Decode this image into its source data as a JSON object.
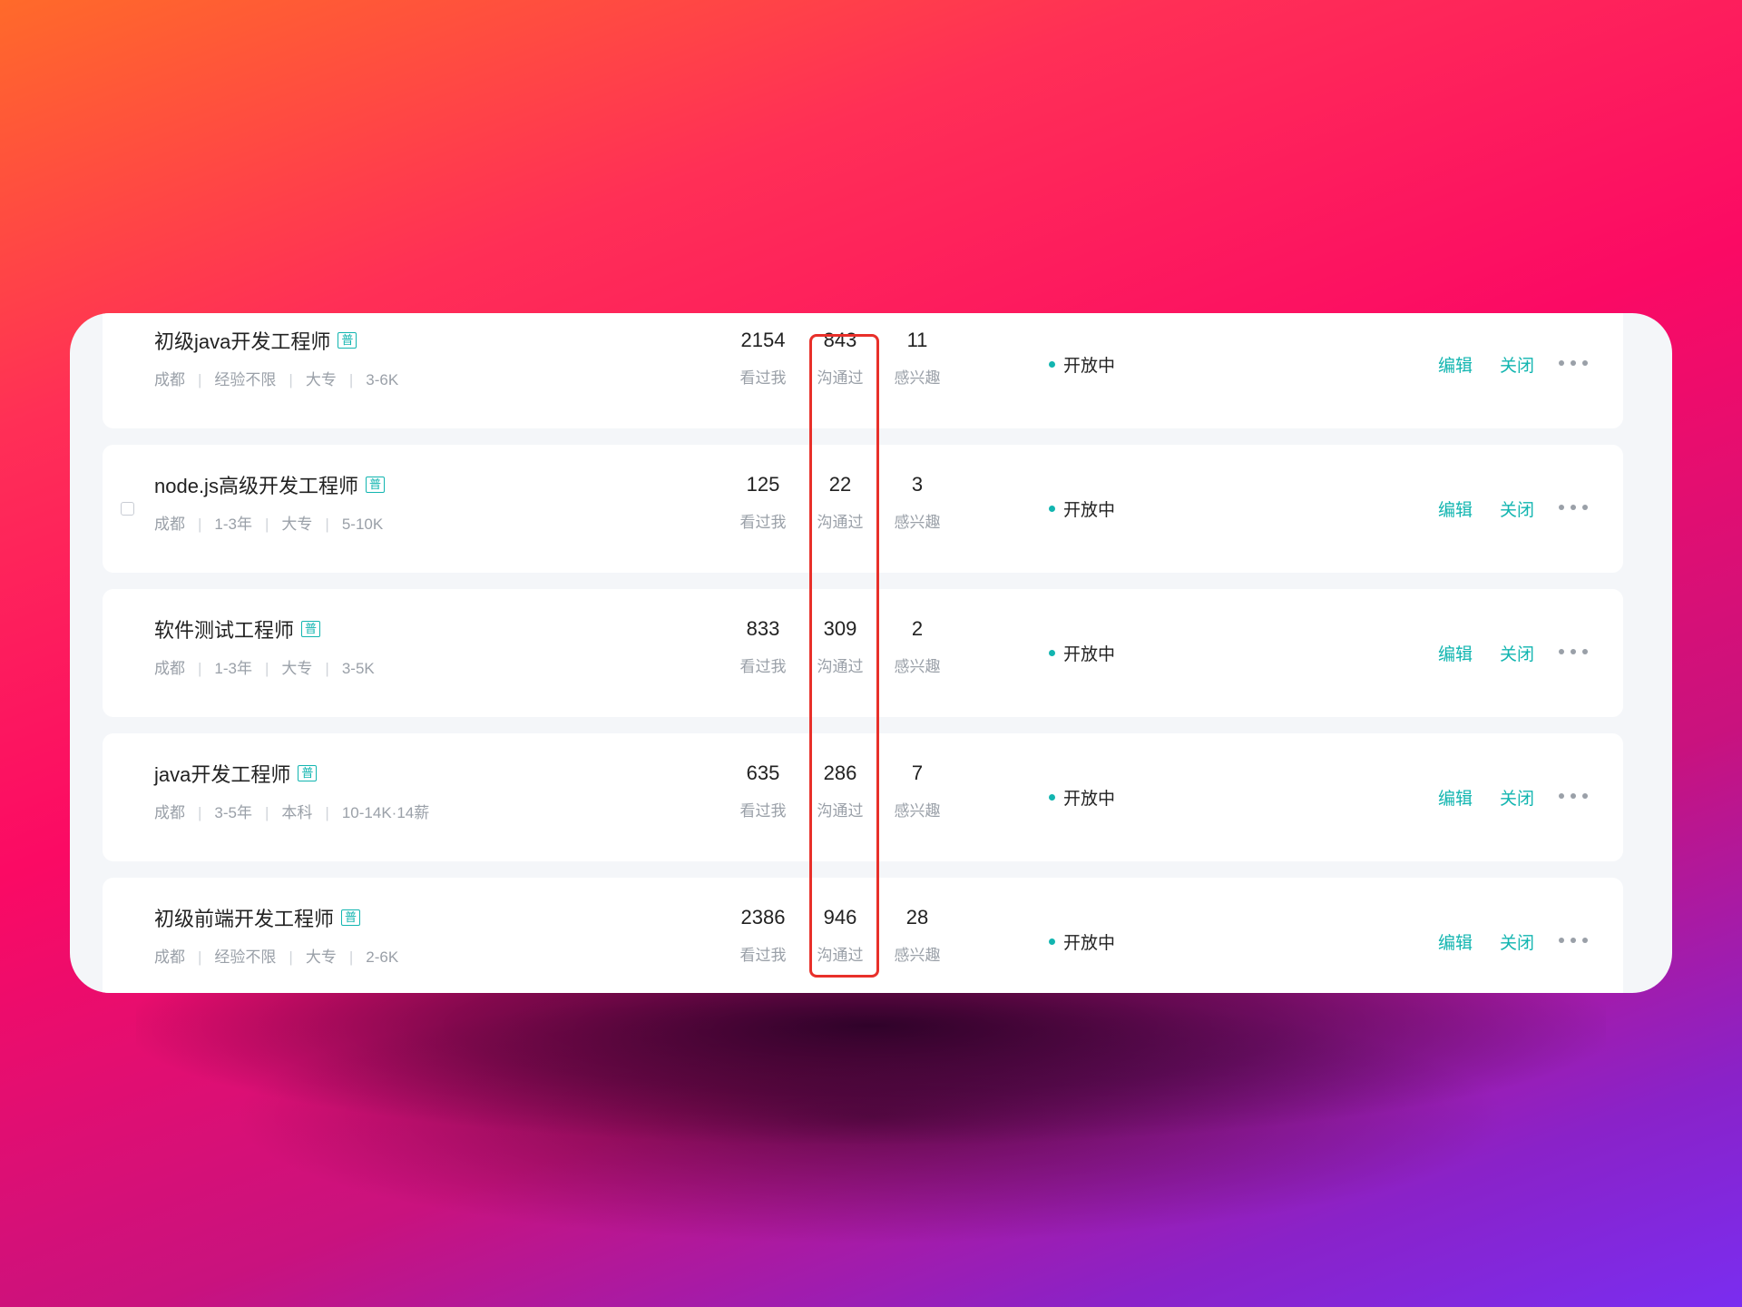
{
  "colors": {
    "accent": "#12b5b0",
    "highlight_border": "#e8302a",
    "status_dot": "#12b5b0"
  },
  "labels": {
    "viewed": "看过我",
    "contacted": "沟通过",
    "interested": "感兴趣",
    "edit": "编辑",
    "close": "关闭"
  },
  "jobs": [
    {
      "title": "初级java开发工程师",
      "tag": "普",
      "city": "成都",
      "experience": "经验不限",
      "education": "大专",
      "salary": "3-6K",
      "viewed": "2154",
      "contacted": "843",
      "interested": "11",
      "status": "开放中"
    },
    {
      "title": "node.js高级开发工程师",
      "tag": "普",
      "city": "成都",
      "experience": "1-3年",
      "education": "大专",
      "salary": "5-10K",
      "viewed": "125",
      "contacted": "22",
      "interested": "3",
      "status": "开放中"
    },
    {
      "title": "软件测试工程师",
      "tag": "普",
      "city": "成都",
      "experience": "1-3年",
      "education": "大专",
      "salary": "3-5K",
      "viewed": "833",
      "contacted": "309",
      "interested": "2",
      "status": "开放中"
    },
    {
      "title": "java开发工程师",
      "tag": "普",
      "city": "成都",
      "experience": "3-5年",
      "education": "本科",
      "salary": "10-14K·14薪",
      "viewed": "635",
      "contacted": "286",
      "interested": "7",
      "status": "开放中"
    },
    {
      "title": "初级前端开发工程师",
      "tag": "普",
      "city": "成都",
      "experience": "经验不限",
      "education": "大专",
      "salary": "2-6K",
      "viewed": "2386",
      "contacted": "946",
      "interested": "28",
      "status": "开放中"
    }
  ]
}
